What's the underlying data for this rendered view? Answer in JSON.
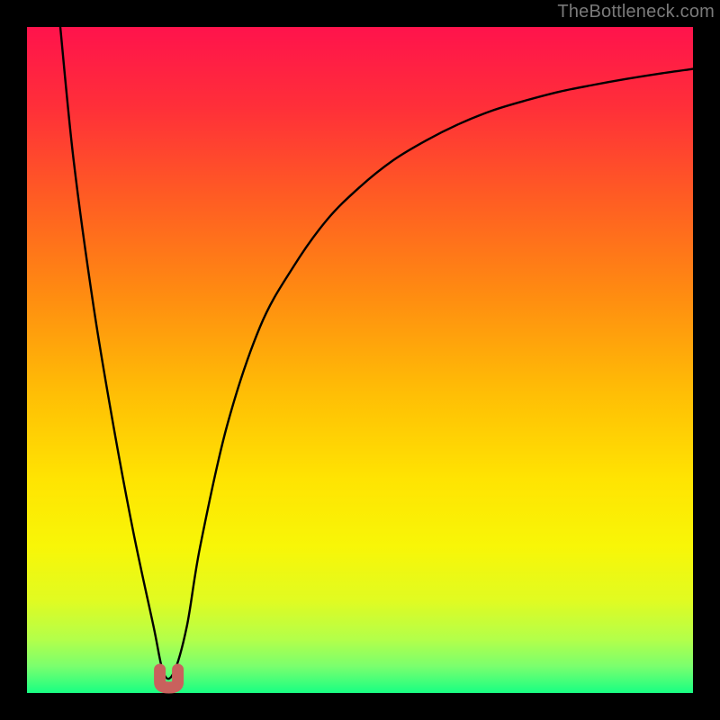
{
  "watermark": "TheBottleneck.com",
  "chart_data": {
    "type": "line",
    "title": "",
    "xlabel": "",
    "ylabel": "",
    "xlim": [
      0,
      100
    ],
    "ylim": [
      0,
      100
    ],
    "note": "Axes unlabeled; values are percentage estimates read from the figure. Single black V-shaped curve over a vertical red→green gradient background.",
    "series": [
      {
        "name": "curve",
        "x": [
          5,
          7,
          10,
          13,
          16,
          19,
          20.5,
          22,
          24,
          26,
          30,
          35,
          40,
          45,
          50,
          55,
          60,
          65,
          70,
          75,
          80,
          85,
          90,
          95,
          100
        ],
        "y": [
          100,
          80,
          58,
          40,
          24,
          10,
          3,
          3,
          10,
          22,
          40,
          55,
          64,
          71,
          76,
          80,
          83,
          85.5,
          87.5,
          89,
          90.3,
          91.3,
          92.2,
          93,
          93.7
        ]
      }
    ],
    "overlay": {
      "type": "marker",
      "name": "bottom-marker",
      "x": 21.3,
      "color": "#c9615d"
    },
    "background_gradient": {
      "stops": [
        {
          "offset": 0.0,
          "color": "#ff134c"
        },
        {
          "offset": 0.12,
          "color": "#ff2f39"
        },
        {
          "offset": 0.25,
          "color": "#ff5a24"
        },
        {
          "offset": 0.4,
          "color": "#ff8b11"
        },
        {
          "offset": 0.55,
          "color": "#ffbe05"
        },
        {
          "offset": 0.68,
          "color": "#ffe402"
        },
        {
          "offset": 0.78,
          "color": "#f8f607"
        },
        {
          "offset": 0.86,
          "color": "#e1fb21"
        },
        {
          "offset": 0.92,
          "color": "#b3ff4a"
        },
        {
          "offset": 0.96,
          "color": "#7aff6e"
        },
        {
          "offset": 1.0,
          "color": "#18ff83"
        }
      ]
    },
    "frame": {
      "outer": 800,
      "inner_left": 30,
      "inner_top": 30,
      "inner_width": 740,
      "inner_height": 740
    }
  }
}
